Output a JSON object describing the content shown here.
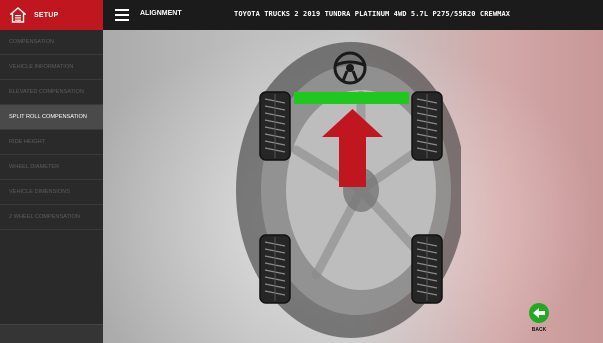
{
  "header": {
    "setup_label": "SETUP",
    "section_title": "ALIGNMENT",
    "vehicle": "TOYOTA TRUCKS 2 2019 TUNDRA PLATINUM 4WD 5.7L P275/55R20 CREWMAX",
    "accent_color": "#c0161f"
  },
  "sidebar": {
    "items": [
      {
        "label": "COMPENSATION",
        "active": false
      },
      {
        "label": "VEHICLE INFORMATION",
        "active": false
      },
      {
        "label": "ELEVATED COMPENSATION",
        "active": false
      },
      {
        "label": "SPLIT ROLL COMPENSATION",
        "active": true
      },
      {
        "label": "RIDE HEIGHT",
        "active": false
      },
      {
        "label": "WHEEL DIAMETER",
        "active": false
      },
      {
        "label": "VEHICLE DIMENSIONS",
        "active": false
      },
      {
        "label": "2 WHEEL COMPENSATION",
        "active": false
      }
    ]
  },
  "main": {
    "icons": [
      "steering-wheel-icon",
      "tire-icon",
      "up-arrow-icon"
    ],
    "indicator_color": "#1ec81e",
    "arrow_color": "#c0161f",
    "back_label": "BACK"
  }
}
